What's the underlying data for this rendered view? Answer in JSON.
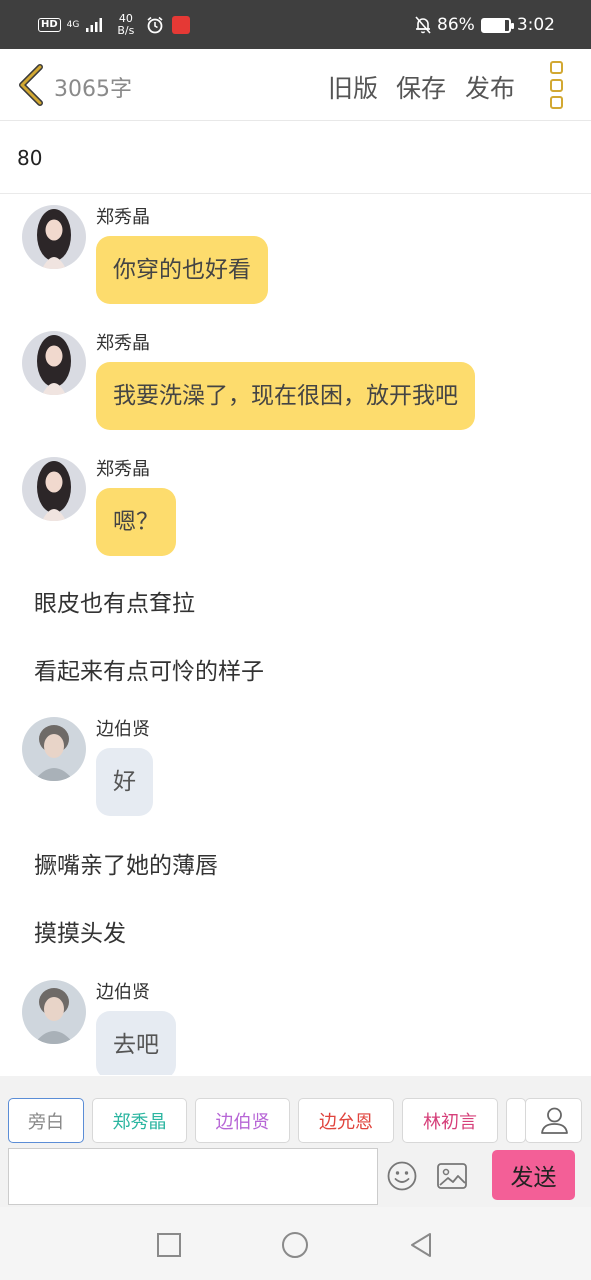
{
  "status_bar": {
    "hd": "HD",
    "network": "4G",
    "speed_value": "40",
    "speed_unit": "B/s",
    "battery": "86%",
    "battery_level": 0.86,
    "time": "3:02"
  },
  "top_bar": {
    "word_count": "3065字",
    "old_version": "旧版",
    "save": "保存",
    "publish": "发布"
  },
  "title": "80",
  "messages": [
    {
      "type": "bubble",
      "speaker": "郑秀晶",
      "text": "你穿的也好看",
      "style": "yellow",
      "avatar": "female-avatar"
    },
    {
      "type": "bubble",
      "speaker": "郑秀晶",
      "text": "我要洗澡了，现在很困，放开我吧",
      "style": "yellow",
      "avatar": "female-avatar"
    },
    {
      "type": "bubble",
      "speaker": "郑秀晶",
      "text": "嗯？",
      "style": "yellow",
      "avatar": "female-avatar"
    },
    {
      "type": "narration",
      "text": "眼皮也有点耷拉"
    },
    {
      "type": "narration",
      "text": "看起来有点可怜的样子"
    },
    {
      "type": "bubble",
      "speaker": "边伯贤",
      "text": "好",
      "style": "gray",
      "avatar": "male-avatar"
    },
    {
      "type": "narration",
      "text": "撅嘴亲了她的薄唇"
    },
    {
      "type": "narration",
      "text": "摸摸头发"
    },
    {
      "type": "bubble",
      "speaker": "边伯贤",
      "text": "去吧",
      "style": "gray",
      "avatar": "male-avatar"
    }
  ],
  "characters": [
    {
      "label": "旁白",
      "color": "#888888"
    },
    {
      "label": "郑秀晶",
      "color": "#2bb5a0"
    },
    {
      "label": "边伯贤",
      "color": "#b766d6"
    },
    {
      "label": "边允恩",
      "color": "#e0443d"
    },
    {
      "label": "林初言",
      "color": "#d6407a"
    }
  ],
  "composer": {
    "input_value": "",
    "send_label": "发送",
    "send_color": "#f35f97"
  },
  "icons": {
    "back": "chevron-left-icon",
    "menu": "more-vert-icon",
    "person": "person-icon",
    "emoji": "smiley-icon",
    "image": "image-icon",
    "nav_recent": "square-icon",
    "nav_home": "circle-icon",
    "nav_back": "triangle-back-icon"
  },
  "colors": {
    "accent": "#d2a832",
    "bubble_yellow": "#fddc6d",
    "bubble_gray": "#e6ebf2",
    "active_chip_border": "#5b8dd6"
  }
}
